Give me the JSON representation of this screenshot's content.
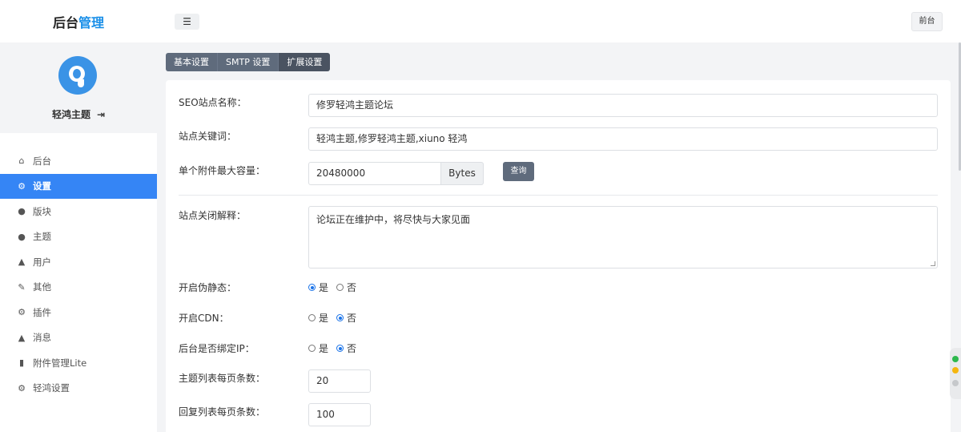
{
  "brand": {
    "part1": "后台",
    "part2": "管理"
  },
  "header": {
    "menu_icon": "☰",
    "front_label": "前台"
  },
  "profile": {
    "name": "轻鸿主题",
    "logout_icon": "⇥"
  },
  "nav": [
    {
      "icon": "⌂",
      "label": "后台"
    },
    {
      "icon": "⚙",
      "label": "设置"
    },
    {
      "icon": "●",
      "label": "版块"
    },
    {
      "icon": "●",
      "label": "主题"
    },
    {
      "icon": "▲",
      "label": "用户"
    },
    {
      "icon": "✎",
      "label": "其他"
    },
    {
      "icon": "⚙",
      "label": "插件"
    },
    {
      "icon": "▲",
      "label": "消息"
    },
    {
      "icon": "▮",
      "label": "附件管理Lite"
    },
    {
      "icon": "⚙",
      "label": "轻鸿设置"
    }
  ],
  "tabs": [
    "基本设置",
    "SMTP 设置",
    "扩展设置"
  ],
  "form": {
    "seo_label": "SEO站点名称：",
    "seo_value": "修罗轻鸿主题论坛",
    "keywords_label": "站点关键词：",
    "keywords_value": "轻鸿主题,修罗轻鸿主题,xiuno 轻鸿",
    "attach_label": "单个附件最大容量：",
    "attach_value": "20480000",
    "attach_unit": "Bytes",
    "query_label": "查询",
    "close_label": "站点关闭解释：",
    "close_value": "论坛正在维护中，将尽快与大家见面",
    "rewrite_label": "开启伪静态：",
    "cdn_label": "开启CDN：",
    "bindip_label": "后台是否绑定IP：",
    "yes": "是",
    "no": "否",
    "pagesize_label": "主题列表每页条数：",
    "pagesize_value": "20",
    "reply_label": "回复列表每页条数：",
    "reply_value": "100"
  },
  "colors": {
    "accent": "#3585f5",
    "brand_accent": "#1a8fe8",
    "tab_bg": "#5f6b7c"
  }
}
